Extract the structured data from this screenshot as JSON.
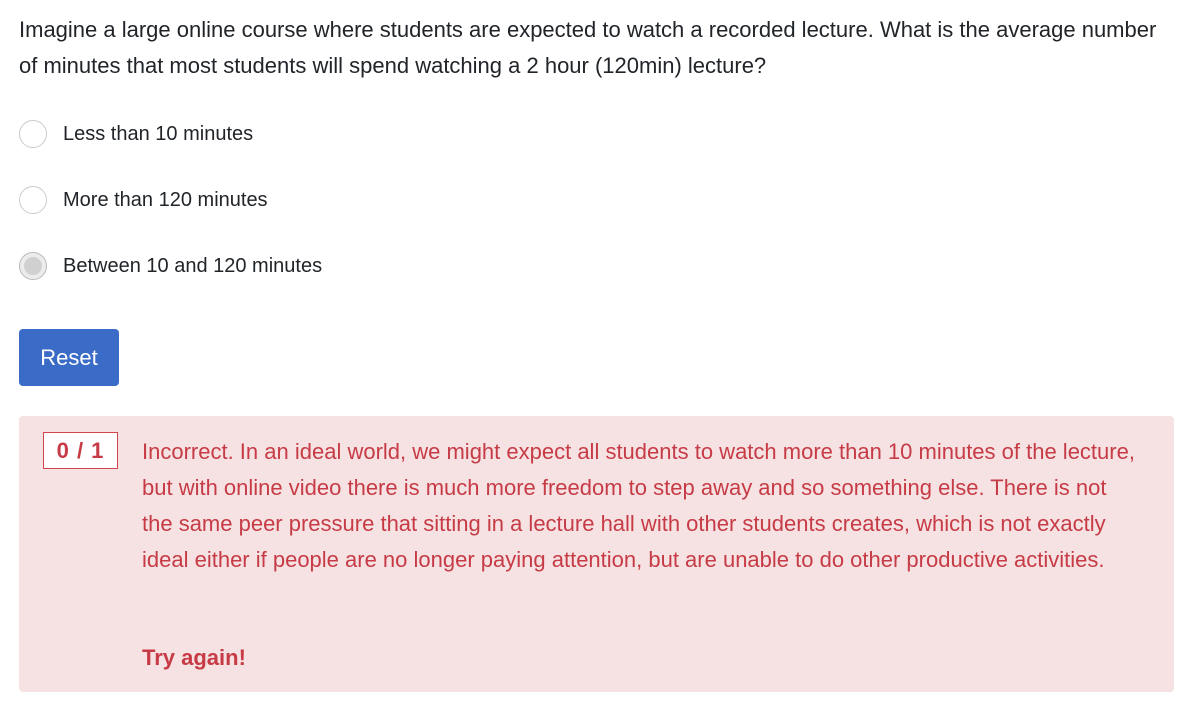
{
  "question": {
    "text": "Imagine a large online course where students are expected to watch a recorded lecture. What is the average number of minutes that most students will spend watching a 2 hour (120min) lecture?"
  },
  "options": [
    {
      "label": "Less than 10 minutes",
      "selected": false
    },
    {
      "label": "More than 120 minutes",
      "selected": false
    },
    {
      "label": "Between 10 and 120 minutes",
      "selected": true
    }
  ],
  "reset_button": {
    "label": "Reset"
  },
  "feedback": {
    "score": "0 / 1",
    "message": "Incorrect. In an ideal world, we might expect all students to watch more than 10 minutes of the lecture, but with online video there is much more freedom to step away and so something else. There is not the same peer pressure that sitting in a lecture hall with other students creates, which is not exactly ideal either if people are no longer paying attention, but are unable to do other productive activities.",
    "try_again": "Try again!"
  },
  "colors": {
    "primary_button": "#3a6bc6",
    "feedback_bg": "#f6e2e3",
    "feedback_text": "#c63b45"
  }
}
